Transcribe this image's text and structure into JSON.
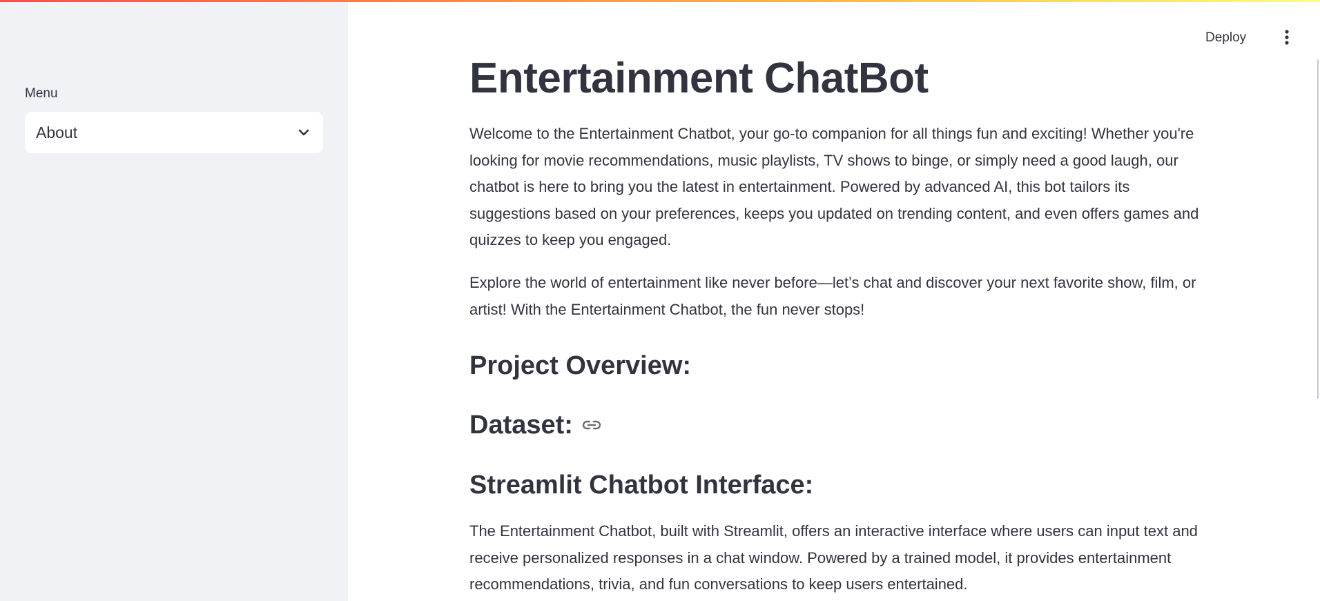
{
  "sidebar": {
    "menu_label": "Menu",
    "selected_option": "About"
  },
  "header": {
    "deploy_label": "Deploy",
    "menu_icon": "more-vertical-icon"
  },
  "main": {
    "title": "Entertainment ChatBot",
    "intro_paragraph": "Welcome to the Entertainment Chatbot, your go-to companion for all things fun and exciting! Whether you're looking for movie recommendations, music playlists, TV shows to binge, or simply need a good laugh, our chatbot is here to bring you the latest in entertainment. Powered by advanced AI, this bot tailors its suggestions based on your preferences, keeps you updated on trending content, and even offers games and quizzes to keep you engaged.",
    "explore_paragraph": "Explore the world of entertainment like never before—let’s chat and discover your next favorite show, film, or artist! With the Entertainment Chatbot, the fun never stops!",
    "project_overview_heading": "Project Overview:",
    "dataset_heading": "Dataset:",
    "dataset_link_icon": "link-icon",
    "interface_heading": "Streamlit Chatbot Interface:",
    "interface_paragraph": "The Entertainment Chatbot, built with Streamlit, offers an interactive interface where users can input text and receive personalized responses in a chat window. Powered by a trained model, it provides entertainment recommendations, trivia, and fun conversations to keep users entertained."
  },
  "colors": {
    "text": "#31333f",
    "sidebar_bg": "#f0f2f6",
    "accent_gradient_start": "#ff4b4b",
    "accent_gradient_end": "#fffd80"
  }
}
